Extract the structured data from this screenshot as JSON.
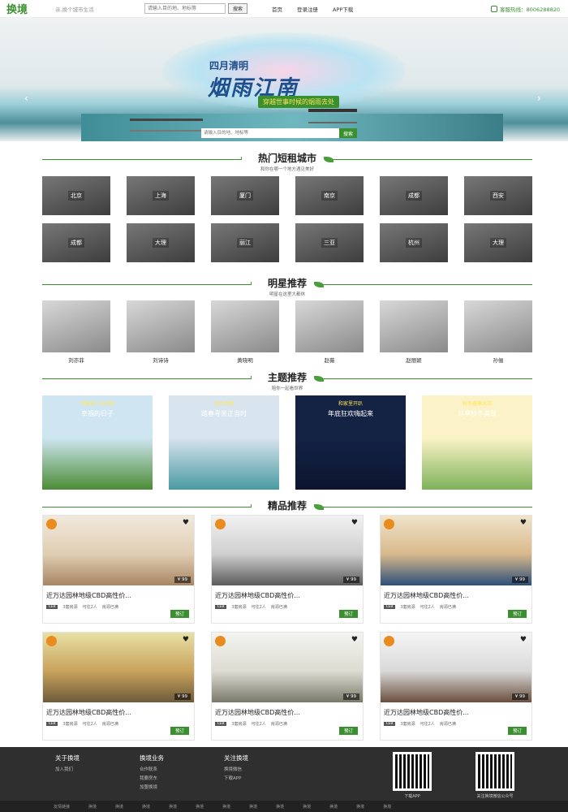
{
  "header": {
    "logo": "换境",
    "slogan": "亲,换个城市生活",
    "search_placeholder": "请输入目的地、地标等",
    "search_button": "搜索",
    "nav": [
      "首页",
      "登录注册",
      "APP下载"
    ],
    "hotline": "客服热线：8006288820"
  },
  "banner": {
    "line1": "四月清明",
    "line2": "烟雨江南",
    "line3": "穿越世事时候的烟雨去处",
    "search_placeholder": "请输入目的地、地标等",
    "search_button": "搜索",
    "dots": 3
  },
  "sections": {
    "cities": {
      "title": "热门短租城市",
      "subtitle": "和你在哪一个地方遇见美好"
    },
    "stars": {
      "title": "明星推荐",
      "subtitle": "明星在这里大都休"
    },
    "themes": {
      "title": "主题推荐",
      "subtitle": "陪你一起看世界"
    },
    "products": {
      "title": "精品推荐"
    }
  },
  "cities": [
    "北京",
    "上海",
    "厦门",
    "南京",
    "成都",
    "西安",
    "成都",
    "大理",
    "丽江",
    "三亚",
    "杭州",
    "大理"
  ],
  "stars": [
    "刘亦菲",
    "刘诗诗",
    "黄晓明",
    "赵薇",
    "赵丽颖",
    "孙俪"
  ],
  "themes": [
    {
      "caption": "带着家人去旅游",
      "title": "幸福的日子",
      "bg": [
        "#cfe6f2",
        "#4a8c35"
      ]
    },
    {
      "caption": "四月清明",
      "title": "踏春寻景正当时",
      "bg": [
        "#d8e4ee",
        "#4a9aa2"
      ]
    },
    {
      "caption": "和家里开趴",
      "title": "年底狂欢嗨起来",
      "bg": [
        "#142244",
        "#0b1530"
      ]
    },
    {
      "caption": "秋冬避寒出游",
      "title": "尽享秋冬美景",
      "bg": [
        "#fbf3c7",
        "#7fb25a"
      ]
    }
  ],
  "products": [
    {
      "title": "近万达园林地级CBD高性价...",
      "tag": "LEB",
      "meta": [
        "3套房源",
        "可住2人",
        "房源已满"
      ],
      "price": "¥ 99",
      "button": "预订"
    },
    {
      "title": "近万达园林地级CBD高性价...",
      "tag": "LEB",
      "meta": [
        "3套房源",
        "可住2人",
        "房源已满"
      ],
      "price": "¥ 99",
      "button": "预订"
    },
    {
      "title": "近万达园林地级CBD高性价...",
      "tag": "LEB",
      "meta": [
        "3套房源",
        "可住2人",
        "房源已满"
      ],
      "price": "¥ 99",
      "button": "预订"
    },
    {
      "title": "近万达园林地级CBD高性价...",
      "tag": "LEB",
      "meta": [
        "3套房源",
        "可住2人",
        "房源已满"
      ],
      "price": "¥ 99",
      "button": "预订"
    },
    {
      "title": "近万达园林地级CBD高性价...",
      "tag": "LEB",
      "meta": [
        "3套房源",
        "可住2人",
        "房源已满"
      ],
      "price": "¥ 99",
      "button": "预订"
    },
    {
      "title": "近万达园林地级CBD高性价...",
      "tag": "LEB",
      "meta": [
        "3套房源",
        "可住2人",
        "房源已满"
      ],
      "price": "¥ 99",
      "button": "预订"
    }
  ],
  "footer": {
    "cols": [
      {
        "title": "关于换境",
        "items": [
          "加入我们"
        ]
      },
      {
        "title": "换境业务",
        "items": [
          "合作联系",
          "我要房东",
          "加盟换境"
        ]
      },
      {
        "title": "关注换境",
        "items": [
          "换境微信",
          "下载APP"
        ]
      }
    ],
    "qr_labels": [
      "下载APP",
      "关注换境微信公众号"
    ],
    "bar": [
      "友情链接",
      "换境",
      "换境",
      "换境",
      "换境",
      "换境",
      "换境",
      "换境",
      "换境",
      "换境",
      "换境",
      "换境",
      "换境"
    ]
  },
  "colors": {
    "brand": "#3a8f2e",
    "footer": "#2f2f2f"
  }
}
